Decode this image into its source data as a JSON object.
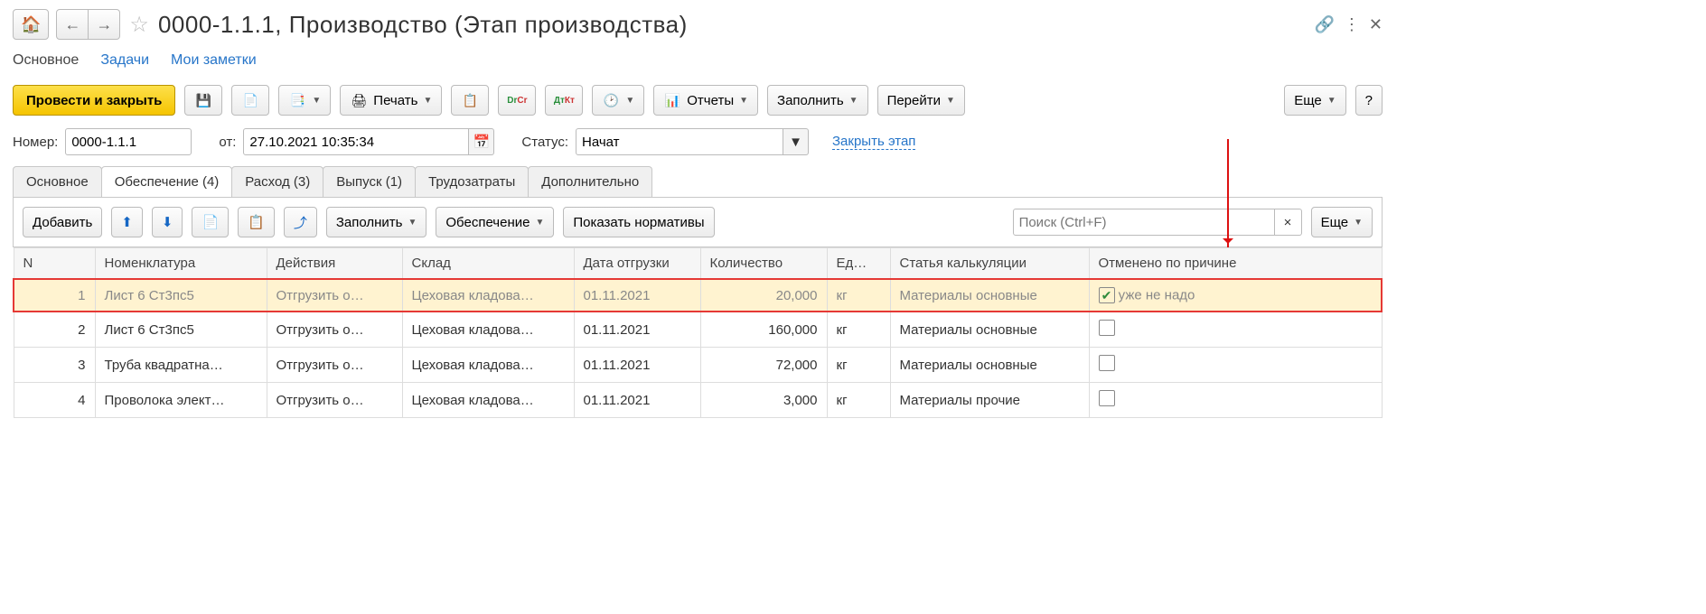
{
  "header": {
    "title": "0000-1.1.1, Производство (Этап производства)"
  },
  "linkbar": {
    "current": "Основное",
    "tasks": "Задачи",
    "notes": "Мои заметки"
  },
  "toolbar": {
    "primary": "Провести и закрыть",
    "print": "Печать",
    "reports": "Отчеты",
    "fill": "Заполнить",
    "goto": "Перейти",
    "more": "Еще",
    "help": "?"
  },
  "fields": {
    "number_label": "Номер:",
    "number_value": "0000-1.1.1",
    "from_label": "от:",
    "date_value": "27.10.2021 10:35:34",
    "status_label": "Статус:",
    "status_value": "Начат",
    "close_stage": "Закрыть этап"
  },
  "tabs": {
    "t1": "Основное",
    "t2": "Обеспечение (4)",
    "t3": "Расход (3)",
    "t4": "Выпуск (1)",
    "t5": "Трудозатраты",
    "t6": "Дополнительно"
  },
  "subbar": {
    "add": "Добавить",
    "fill": "Заполнить",
    "supply": "Обеспечение",
    "norms": "Показать нормативы",
    "search_ph": "Поиск (Ctrl+F)",
    "more": "Еще"
  },
  "table": {
    "headers": {
      "n": "N",
      "nomen": "Номенклатура",
      "actions": "Действия",
      "wh": "Склад",
      "ship": "Дата отгрузки",
      "qty": "Количество",
      "unit": "Ед…",
      "calc": "Статья калькуляции",
      "cancel": "Отменено по причине"
    },
    "rows": [
      {
        "n": "1",
        "nomen": "Лист 6 Ст3пс5",
        "actions": "Отгрузить о…",
        "wh": "Цеховая кладова…",
        "ship": "01.11.2021",
        "qty": "20,000",
        "unit": "кг",
        "calc": "Материалы основные",
        "cancel_chk": true,
        "cancel_txt": "уже не надо",
        "hl": true
      },
      {
        "n": "2",
        "nomen": "Лист 6 Ст3пс5",
        "actions": "Отгрузить о…",
        "wh": "Цеховая кладова…",
        "ship": "01.11.2021",
        "qty": "160,000",
        "unit": "кг",
        "calc": "Материалы основные",
        "cancel_chk": false,
        "cancel_txt": ""
      },
      {
        "n": "3",
        "nomen": "Труба квадратна…",
        "actions": "Отгрузить о…",
        "wh": "Цеховая кладова…",
        "ship": "01.11.2021",
        "qty": "72,000",
        "unit": "кг",
        "calc": "Материалы основные",
        "cancel_chk": false,
        "cancel_txt": ""
      },
      {
        "n": "4",
        "nomen": "Проволока элект…",
        "actions": "Отгрузить о…",
        "wh": "Цеховая кладова…",
        "ship": "01.11.2021",
        "qty": "3,000",
        "unit": "кг",
        "calc": "Материалы прочие",
        "cancel_chk": false,
        "cancel_txt": ""
      }
    ]
  }
}
